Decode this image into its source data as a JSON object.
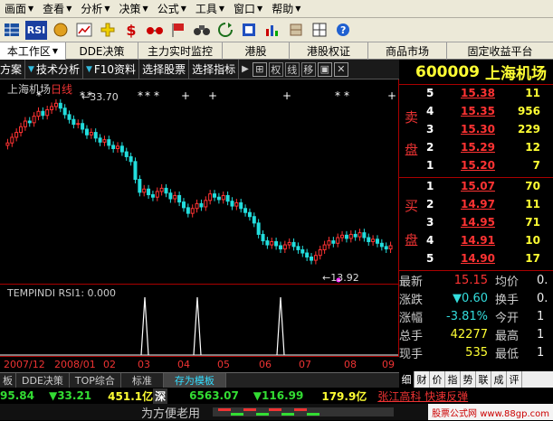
{
  "menu": {
    "items": [
      "画面",
      "查看",
      "分析",
      "决策",
      "公式",
      "工具",
      "窗口",
      "帮助"
    ]
  },
  "toolbar": {
    "icons": [
      "rsi-icon",
      "coin-icon",
      "chart-icon",
      "plus-icon",
      "dollar-icon",
      "glasses-icon",
      "flag-icon",
      "binoculars-icon",
      "refresh-icon",
      "book-icon",
      "bars-icon",
      "tool-icon",
      "grid-icon",
      "help-icon"
    ],
    "rsi_label": "RSI",
    "dollar_label": "$"
  },
  "tabs_top": [
    "本工作区",
    "DDE决策",
    "主力实时监控",
    "港股",
    "港股权证",
    "商品市场",
    "固定收益平台"
  ],
  "tabs_chart": {
    "t1": "方案",
    "t2": "技术分析",
    "t3": "F10资料",
    "t4": "选择股票",
    "t5": "选择指标",
    "sq1": "权",
    "sq2": "线",
    "sq3": "移"
  },
  "chart": {
    "title": "上海机场",
    "period": "日线",
    "high_label": "33.70",
    "low_label": "13.92",
    "indicator_label": "TEMPINDI RSI1: 0.000"
  },
  "chart_data": {
    "type": "candlestick",
    "title": "上海机场 日线",
    "x_ticks": [
      "2007/12",
      "2008/01",
      "02",
      "03",
      "04",
      "05",
      "06",
      "07",
      "08",
      "09"
    ],
    "annotations": {
      "high": 33.7,
      "low": 13.92
    },
    "ylim": [
      12,
      35
    ],
    "closes": [
      28.5,
      29.2,
      29.8,
      30.5,
      31.2,
      31.0,
      31.8,
      32.4,
      31.9,
      32.6,
      33.0,
      33.4,
      32.8,
      32.0,
      31.4,
      30.8,
      30.9,
      30.2,
      29.5,
      29.8,
      29.1,
      28.6,
      28.9,
      28.2,
      27.8,
      28.1,
      27.4,
      26.8,
      26.2,
      24.0,
      22.4,
      22.8,
      22.1,
      21.8,
      22.5,
      22.9,
      22.3,
      21.6,
      22.0,
      21.2,
      20.5,
      19.8,
      20.4,
      21.0,
      20.6,
      21.4,
      22.2,
      21.8,
      21.5,
      22.0,
      21.3,
      20.7,
      21.1,
      20.4,
      19.9,
      19.4,
      18.6,
      17.2,
      16.4,
      15.9,
      16.3,
      15.8,
      15.4,
      15.9,
      16.2,
      15.7,
      15.3,
      14.9,
      14.4,
      14.0,
      14.6,
      15.3,
      15.9,
      16.4,
      16.1,
      16.8,
      17.1,
      16.7,
      17.2,
      16.9,
      17.4,
      16.8,
      16.3,
      16.6,
      16.1,
      15.7,
      15.4,
      15.8
    ],
    "signals": [
      10,
      13,
      24,
      33
    ]
  },
  "dates": {
    "d1": "2007/12",
    "d2": "2008/01",
    "d3": "02",
    "d4": "03",
    "d5": "04",
    "d6": "05",
    "d7": "06",
    "d8": "07",
    "d9": "08",
    "d10": "09"
  },
  "bottom_tabs": [
    "板",
    "DDE决策",
    "TOP综合",
    "标准",
    "存为模板"
  ],
  "quote": {
    "code": "600009",
    "name": "上海机场",
    "sell_side": "卖盘",
    "buy_side": "买盘",
    "sell": [
      {
        "lv": "5",
        "price": "15.38",
        "vol": "11"
      },
      {
        "lv": "4",
        "price": "15.35",
        "vol": "956"
      },
      {
        "lv": "3",
        "price": "15.30",
        "vol": "229"
      },
      {
        "lv": "2",
        "price": "15.29",
        "vol": "12"
      },
      {
        "lv": "1",
        "price": "15.20",
        "vol": "7"
      }
    ],
    "buy": [
      {
        "lv": "1",
        "price": "15.07",
        "vol": "70"
      },
      {
        "lv": "2",
        "price": "14.97",
        "vol": "11"
      },
      {
        "lv": "3",
        "price": "14.95",
        "vol": "71"
      },
      {
        "lv": "4",
        "price": "14.91",
        "vol": "10"
      },
      {
        "lv": "5",
        "price": "14.90",
        "vol": "17"
      }
    ],
    "stats": [
      {
        "l": "最新",
        "v": "15.15",
        "l2": "均价",
        "v2": "0."
      },
      {
        "l": "涨跌",
        "v": "▼0.60",
        "l2": "换手",
        "v2": "0."
      },
      {
        "l": "涨幅",
        "v": "-3.81%",
        "l2": "今开",
        "v2": "1"
      },
      {
        "l": "总手",
        "v": "42277",
        "l2": "最高",
        "v2": "1"
      },
      {
        "l": "现手",
        "v": "535",
        "l2": "最低",
        "v2": "1"
      }
    ],
    "right_tabs": [
      "细",
      "财",
      "价",
      "指",
      "势",
      "联",
      "成",
      "评"
    ]
  },
  "ticker": {
    "a": "95.84",
    "b": "▼33.21",
    "c": "451.1亿",
    "d": "深",
    "e": "6563.07",
    "f": "▼116.99",
    "g": "179.9亿",
    "h": "张江高科 快速反弹"
  },
  "status": {
    "text": "为方便老用",
    "watermark": "股票公式网 www.88gp.com"
  },
  "colors": {
    "up": "#ff3333",
    "down": "#22dddd",
    "accent": "#ffff33"
  }
}
